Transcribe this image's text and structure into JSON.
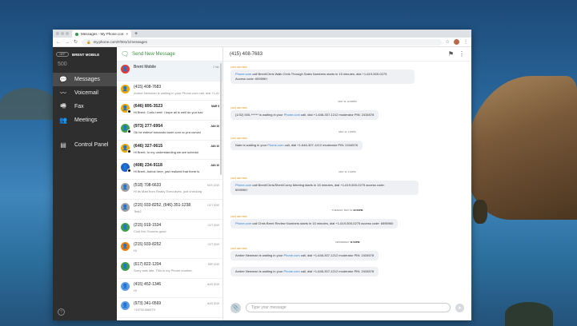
{
  "browser": {
    "tab_title": "Messages - My Phone.com",
    "new_tab": "+",
    "url": "my.phone.com/#/001/1/messages"
  },
  "sidebar": {
    "presence": "OFF",
    "user_name": "BRENT MOBILE",
    "extension": "500",
    "items": [
      {
        "label": "Messages",
        "icon": "chat-icon"
      },
      {
        "label": "Voicemail",
        "icon": "voicemail-icon"
      },
      {
        "label": "Fax",
        "icon": "fax-icon"
      },
      {
        "label": "Meetings",
        "icon": "meetings-icon"
      }
    ],
    "control_panel": "Control Panel",
    "help_icon": "help-icon"
  },
  "list": {
    "send_new": "Send New Message",
    "conversations": [
      {
        "name": "Brent Mobile",
        "preview": "",
        "time": "2 min",
        "color": "#e53935",
        "bold": false
      },
      {
        "name": "(415) 408-7683",
        "preview": "Amber Newman is waiting in your Phone.com call, dial +1-646-307-1212 moderator PIN: 2434578",
        "time": "",
        "color": "#f0a800",
        "bold": false
      },
      {
        "name": "(646) 895-3523",
        "preview": "Hi Brent, Carlo here! I hope all is well do you hav",
        "time": "MAR 5",
        "color": "#f0a800",
        "bold": true
      },
      {
        "name": "(973) 277-6954",
        "preview": "Ok he esteve tomando fazer com vc pra convid",
        "time": "JAN 10",
        "color": "#43a047",
        "bold": true
      },
      {
        "name": "(646) 327-0615",
        "preview": "Hi Brent, to my understanding we are schedul",
        "time": "JAN 10",
        "color": "#f0a800",
        "bold": true
      },
      {
        "name": "(408) 234-9118",
        "preview": "Hi Brent, Ashok here, just realized that there is",
        "time": "JAN 10",
        "color": "#1e63c4",
        "bold": true
      },
      {
        "name": "(518) 708-6633",
        "preview": "Hi its Matt from Realty Executives, just checking",
        "time": "NOV 2019",
        "color": "#9e9e9e",
        "bold": false
      },
      {
        "name": "(215) 933-8252, (646) 351-1238",
        "preview": "Test2",
        "time": "OCT 2019",
        "color": "#9e9e9e",
        "bold": false
      },
      {
        "name": "(215) 919-1534",
        "preview": "Cool thx! Sounds good",
        "time": "OCT 2019",
        "color": "#43a047",
        "bold": false
      },
      {
        "name": "(215) 933-8252",
        "preview": "Hi",
        "time": "OCT 2019",
        "color": "#f57c00",
        "bold": false
      },
      {
        "name": "(617) 822-1204",
        "preview": "Sorry was late. This is my Phone number.",
        "time": "SEP 2019",
        "color": "#43a047",
        "bold": false
      },
      {
        "name": "(415) 452-1346",
        "preview": "Hi",
        "time": "AUG 2019",
        "color": "#5c9be0",
        "bold": false
      },
      {
        "name": "(973) 341-0569",
        "preview": "+19732456979",
        "time": "AUG 2019",
        "color": "#5c9be0",
        "bold": false
      }
    ]
  },
  "chat": {
    "header": "(415) 408-7683",
    "timestamps": [
      {
        "day": "",
        "time": "MAY 11 12:00PM"
      },
      {
        "day": "",
        "time": "MAY 11 1:07PM"
      },
      {
        "day": "",
        "time": "MAY 11 1:11PM"
      },
      {
        "day": "TUESDAY, MAY 12",
        "time": "12:00PM"
      },
      {
        "day": "YESTERDAY",
        "time": "11:53PM"
      }
    ],
    "labels": [
      "(415) 408-7683",
      "(415) 408-7683",
      "(415) 408-7683",
      "(415) 408-7683",
      "(415) 408-7683",
      "(415) 408-7683"
    ],
    "messages": [
      {
        "link": "Phone.com",
        "text": " call Brent/Chris Walk Chris Through Sales Numbers starts in 15 minutes, dial +1-619-500-0275",
        "text2": "Access code: 659596†"
      },
      {
        "text": "(1/32) 505-****** is waiting in your ",
        "link": "Phone.com",
        "text_b": " call, dial +1-646-307-1212 moderator PIN: 2434578"
      },
      {
        "text": "Nate is waiting in your ",
        "link": "Phone.com",
        "text_b": " call, dial +1-646-307-1212 moderator PIN: 2434578"
      },
      {
        "link": "Phone.com",
        "text": " call Brent/Chris/Sheri/Corey Meeting starts in 15 minutes, dial +1-619-500-0275 access code:",
        "text2": "659596†"
      },
      {
        "link": "Phone.com",
        "text": " call Chris Brent Review Numbers starts in 15 minutes, dial +1-619-500-0275 access code: 6595960"
      },
      {
        "text": "Amber Newman is waiting in your ",
        "link": "Phone.com",
        "text_b": " call, dial +1-646-307-1212 moderator PIN: 2434578"
      },
      {
        "text": "Amber Newman is waiting in your ",
        "link": "Phone.com",
        "text_b": " call, dial +1-646-307-1212 moderator PIN: 2434578"
      }
    ],
    "composer_placeholder": "Type your message"
  }
}
